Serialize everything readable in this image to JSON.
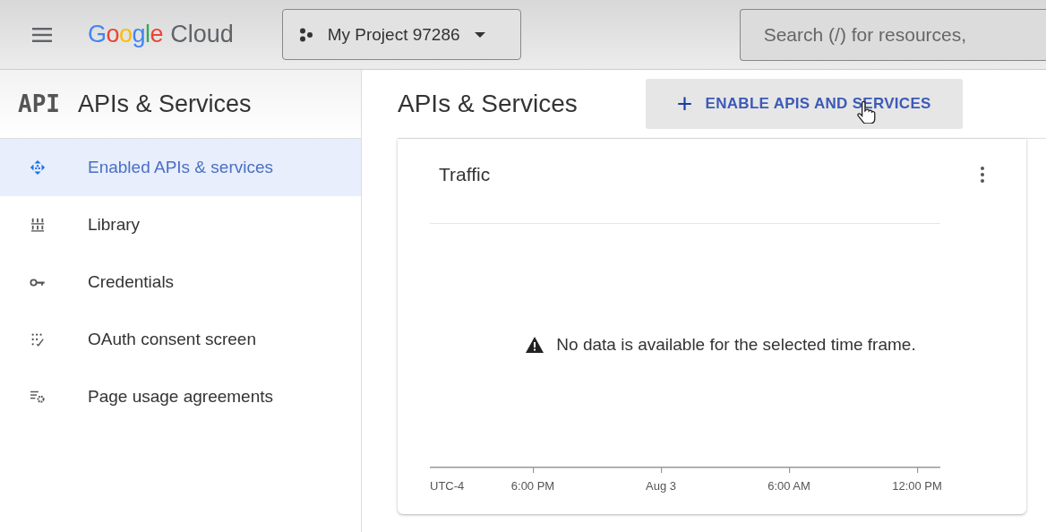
{
  "header": {
    "brand": "Google",
    "product": "Cloud",
    "project": "My Project 97286",
    "search": {
      "placeholder": "Search (/) for resources,"
    }
  },
  "sidebar": {
    "logo": "API",
    "title": "APIs & Services",
    "items": [
      {
        "label": "Enabled APIs & services",
        "kind": "enabled",
        "selected": true
      },
      {
        "label": "Library",
        "kind": "library",
        "selected": false
      },
      {
        "label": "Credentials",
        "kind": "credentials",
        "selected": false
      },
      {
        "label": "OAuth consent screen",
        "kind": "oauth",
        "selected": false
      },
      {
        "label": "Page usage agreements",
        "kind": "agreements",
        "selected": false
      }
    ]
  },
  "main": {
    "title": "APIs & Services",
    "action": {
      "icon": "+",
      "label": "ENABLE APIS AND SERVICES"
    },
    "traffic": {
      "title": "Traffic",
      "message": "No data is available for the selected time frame.",
      "timezone": "UTC-4",
      "axis_labels": [
        "6:00 PM",
        "Aug 3",
        "6:00 AM",
        "12:00 PM"
      ]
    }
  }
}
